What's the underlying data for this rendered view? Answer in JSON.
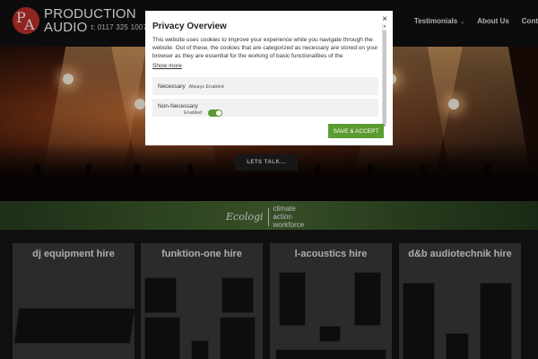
{
  "header": {
    "logo_letters": "PA",
    "logo_line1": "PRODUCTION",
    "logo_line2": "AUDIO",
    "phone": "t: 0117 325 1007",
    "nav": [
      {
        "label": "Testimonials",
        "has_dropdown": true
      },
      {
        "label": "About Us",
        "has_dropdown": false
      },
      {
        "label": "Cont",
        "has_dropdown": false
      }
    ]
  },
  "hero": {
    "cta_label": "LETS TALK..."
  },
  "ecologi": {
    "name": "Ecologi",
    "tagline_lines": [
      "climate",
      "action",
      "workforce"
    ]
  },
  "cards": [
    {
      "title": "dj equipment hire"
    },
    {
      "title": "funktion-one hire"
    },
    {
      "title": "l-acoustics hire"
    },
    {
      "title": "d&b audiotechnik hire"
    }
  ],
  "modal": {
    "title": "Privacy Overview",
    "close_icon": "×",
    "body": "This website uses cookies to improve your experience while you navigate through the website. Out of these, the cookies that are categorized as necessary are stored on your browser as they are essential for the working of basic functionalities of the",
    "show_more": "Show more",
    "settings": [
      {
        "name": "Necessary",
        "status": "Always Enabled"
      },
      {
        "name": "Non-Necessary",
        "status": "Enabled",
        "toggle_on": true
      }
    ],
    "accept_label": "SAVE & ACCEPT"
  },
  "colors": {
    "accent_green": "#5b9b32",
    "logo_red": "#c0312b"
  }
}
